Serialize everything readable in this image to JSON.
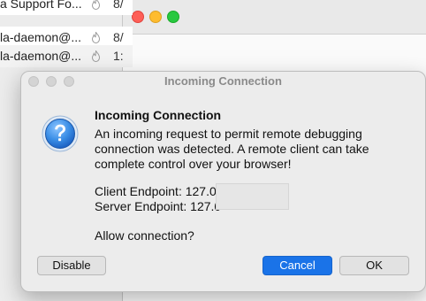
{
  "background": {
    "top_fragment": "--- -- ---",
    "rows": [
      {
        "name": "a Support Fo...",
        "date": "8/"
      },
      {
        "name": "la-daemon@...",
        "date": "8/"
      },
      {
        "name": "la-daemon@...",
        "date": "1:"
      }
    ]
  },
  "dialog": {
    "title": "Incoming Connection",
    "heading": "Incoming Connection",
    "message": "An incoming request to permit remote debugging connection was detected. A remote client can take complete control over your browser!",
    "client_endpoint": "Client Endpoint: 127.0.",
    "server_endpoint": "Server Endpoint: 127.0",
    "question": "Allow connection?",
    "buttons": {
      "disable": "Disable",
      "cancel": "Cancel",
      "ok": "OK"
    },
    "icon": "question-icon",
    "accent_color": "#1a73e8"
  }
}
